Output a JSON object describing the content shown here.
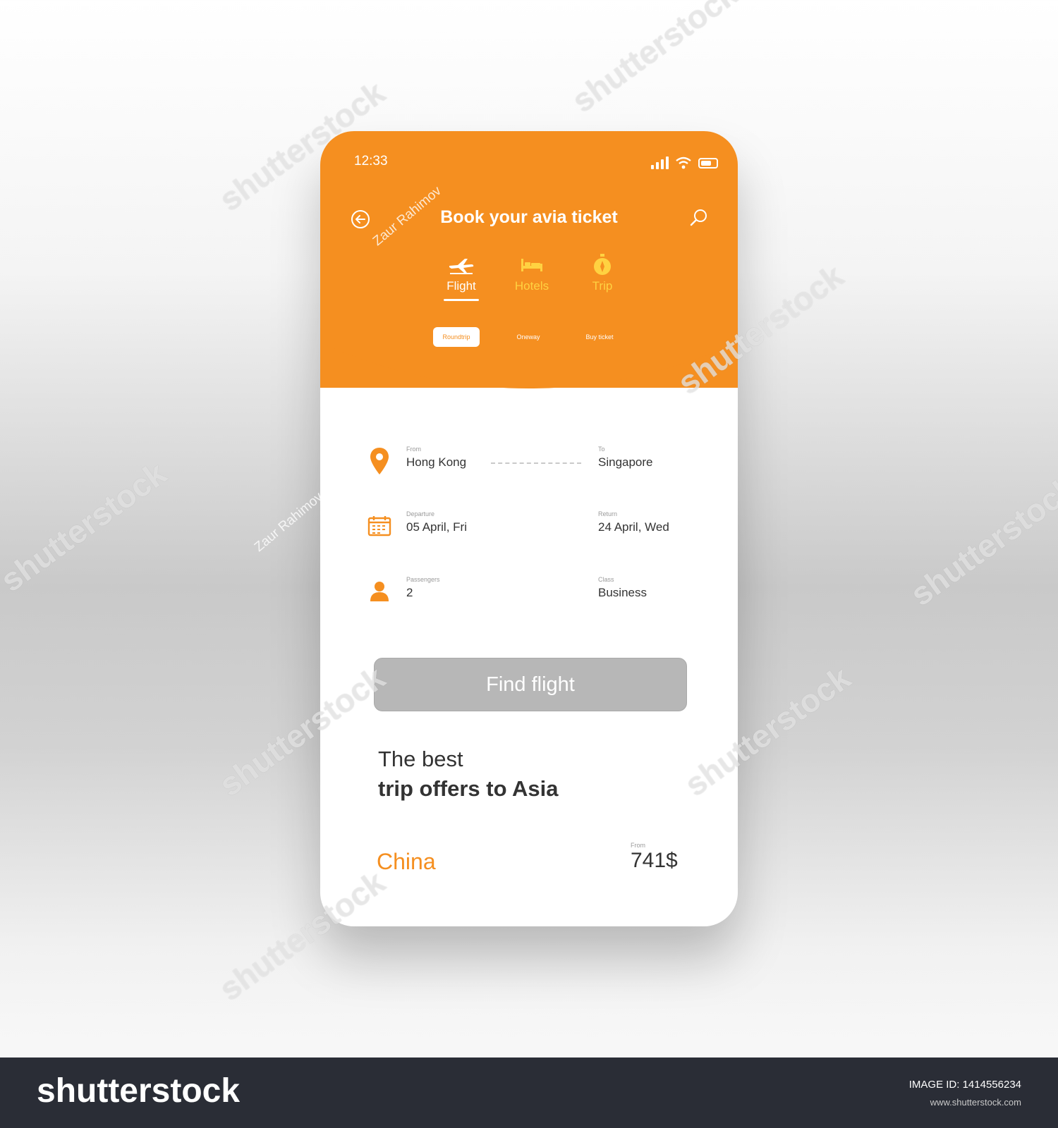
{
  "status_bar": {
    "time": "12:33"
  },
  "header": {
    "title": "Book your avia ticket"
  },
  "mode_tabs": [
    {
      "label": "Flight",
      "icon": "airplane-icon",
      "active": true
    },
    {
      "label": "Hotels",
      "icon": "bed-icon",
      "active": false
    },
    {
      "label": "Trip",
      "icon": "compass-icon",
      "active": false
    }
  ],
  "trip_types": [
    {
      "label": "Roundtrip",
      "active": true
    },
    {
      "label": "Oneway",
      "active": false
    },
    {
      "label": "Buy ticket",
      "active": false
    }
  ],
  "form": {
    "from": {
      "label": "From",
      "value": "Hong Kong"
    },
    "to": {
      "label": "To",
      "value": "Singapore"
    },
    "departure": {
      "label": "Departure",
      "value": "05 April, Fri"
    },
    "return": {
      "label": "Return",
      "value": "24 April, Wed"
    },
    "passengers": {
      "label": "Passengers",
      "value": "2"
    },
    "class": {
      "label": "Class",
      "value": "Business"
    }
  },
  "find_button": {
    "label": "Find flight"
  },
  "offers": {
    "heading_line1": "The best",
    "heading_line2": "trip offers to Asia",
    "item": {
      "country": "China",
      "from_label": "From",
      "price": "741$"
    }
  },
  "watermark": {
    "text": "shutterstock",
    "author": "Zaur Rahimov"
  },
  "footer": {
    "logo": "shutterstock",
    "image_id": "IMAGE ID: 1414556234",
    "url": "www.shutterstock.com"
  },
  "colors": {
    "accent": "#f58f20",
    "accent_light": "#ffd241",
    "button_disabled": "#b7b7b7",
    "text": "#333333"
  }
}
